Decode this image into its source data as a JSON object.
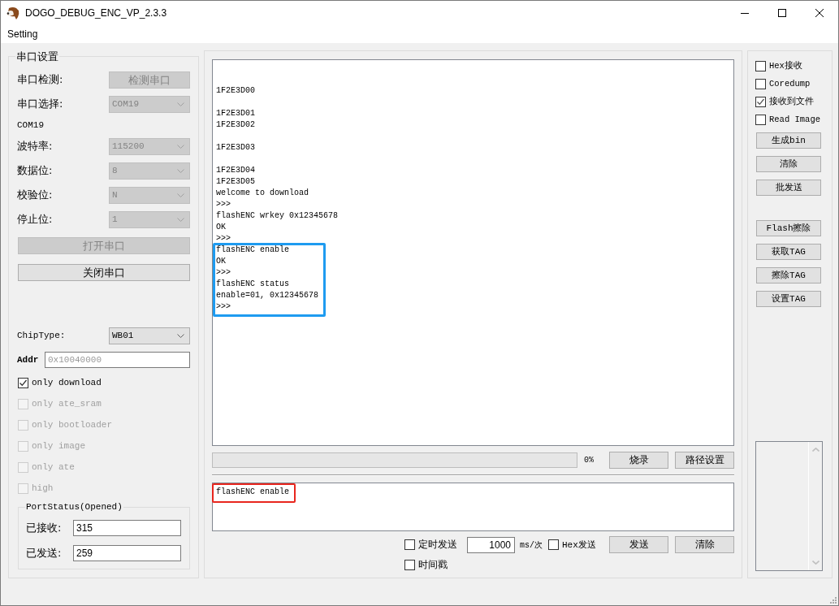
{
  "window": {
    "title": "DOGO_DEBUG_ENC_VP_2.3.3"
  },
  "menu": [
    {
      "label": "Setting"
    }
  ],
  "serial": {
    "title": "串口设置",
    "rows": [
      {
        "kind": "button",
        "label": "串口检测:",
        "text": "检测串口",
        "disabled": true
      },
      {
        "kind": "combo",
        "label": "串口选择:",
        "value": "COM19",
        "disabled": true
      },
      {
        "kind": "note",
        "text": "COM19"
      },
      {
        "kind": "combo",
        "label": "波特率:",
        "value": "115200",
        "disabled": true
      },
      {
        "kind": "combo",
        "label": "数据位:",
        "value": "8",
        "disabled": true
      },
      {
        "kind": "combo",
        "label": "校验位:",
        "value": "N",
        "disabled": true
      },
      {
        "kind": "combo",
        "label": "停止位:",
        "value": "1",
        "disabled": true
      }
    ],
    "buttons": [
      {
        "label": "打开串口",
        "disabled": true
      },
      {
        "label": "关闭串口",
        "disabled": false
      }
    ],
    "chip_type": {
      "label": "ChipType:",
      "value": "WB01"
    },
    "addr": {
      "label": "Addr",
      "placeholder": "0x10040000"
    },
    "options": [
      {
        "label": "only download",
        "checked": true,
        "disabled": false
      },
      {
        "label": "only ate_sram",
        "checked": false,
        "disabled": true
      },
      {
        "label": "only bootloader",
        "checked": false,
        "disabled": true
      },
      {
        "label": "only image",
        "checked": false,
        "disabled": true
      },
      {
        "label": "only ate",
        "checked": false,
        "disabled": true
      },
      {
        "label": "high",
        "checked": false,
        "disabled": true
      }
    ],
    "port_status": {
      "title": "PortStatus(Opened)",
      "fields": [
        {
          "label": "已接收:",
          "value": "315"
        },
        {
          "label": "已发送:",
          "value": "259"
        }
      ]
    }
  },
  "log": {
    "paragraphs": [
      {
        "lines": [
          {
            "text": "1F2E3D00",
            "highlighted": false
          }
        ]
      },
      {
        "lines": [
          {
            "text": "1F2E3D01",
            "highlighted": false
          },
          {
            "text": "1F2E3D02",
            "highlighted": false
          }
        ]
      },
      {
        "lines": [
          {
            "text": "1F2E3D03",
            "highlighted": false
          }
        ]
      },
      {
        "lines": [
          {
            "text": "1F2E3D04",
            "highlighted": false
          },
          {
            "text": "1F2E3D05",
            "highlighted": false
          },
          {
            "text": "welcome to download",
            "highlighted": false
          },
          {
            "text": ">>>",
            "highlighted": false
          },
          {
            "text": "flashENC wrkey 0x12345678",
            "highlighted": false
          },
          {
            "text": "OK",
            "highlighted": false
          },
          {
            "text": ">>>",
            "highlighted": false
          },
          {
            "text": "flashENC enable",
            "highlighted": true
          },
          {
            "text": "OK",
            "highlighted": true
          },
          {
            "text": ">>>",
            "highlighted": true
          },
          {
            "text": "flashENC status",
            "highlighted": true
          },
          {
            "text": "enable=01, 0x12345678",
            "highlighted": true
          },
          {
            "text": ">>>",
            "highlighted": true
          }
        ]
      }
    ]
  },
  "burn": {
    "level": 0,
    "percent": "0%",
    "buttons": [
      {
        "label": "烧录"
      },
      {
        "label": "路径设置"
      }
    ]
  },
  "send": {
    "value": "flashENC enable",
    "highlighted": true
  },
  "send_options": {
    "timed": {
      "label": "定时发送",
      "checked": false
    },
    "interval": "1000",
    "unit": "ms/次",
    "hex": {
      "label": "Hex发送",
      "checked": false
    },
    "buttons": [
      {
        "label": "发送"
      },
      {
        "label": "清除"
      }
    ],
    "timestamp": {
      "label": "时间戳",
      "checked": false
    }
  },
  "receive_options": [
    {
      "label": "Hex接收",
      "checked": false
    },
    {
      "label": "Coredump",
      "checked": false
    },
    {
      "label": "接收到文件",
      "checked": true
    },
    {
      "label": "Read Image",
      "checked": false
    }
  ],
  "tools": {
    "top": [
      {
        "label": "生成bin"
      },
      {
        "label": "清除"
      },
      {
        "label": "批发送"
      }
    ],
    "bottom": [
      {
        "label": "Flash擦除"
      },
      {
        "label": "获取TAG"
      },
      {
        "label": "擦除TAG"
      },
      {
        "label": "设置TAG"
      }
    ]
  }
}
